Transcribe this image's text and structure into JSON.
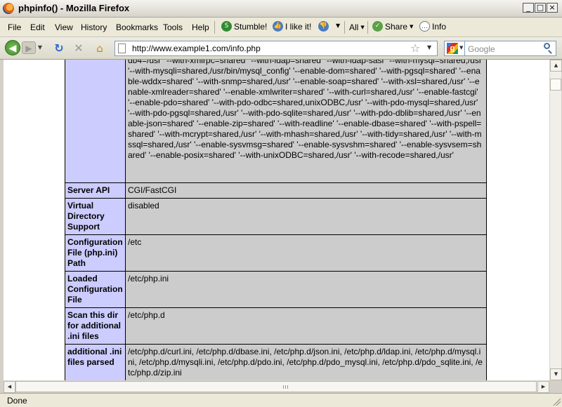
{
  "window": {
    "title": "phpinfo() - Mozilla Firefox",
    "buttons": {
      "minimize": "_",
      "maximize": "□",
      "close": "×"
    }
  },
  "menubar": {
    "items": [
      "File",
      "Edit",
      "View",
      "History",
      "Bookmarks",
      "Tools",
      "Help"
    ]
  },
  "toolbar": {
    "stumble_label": "Stumble!",
    "like_label": "I like it!",
    "all_label": "All",
    "share_label": "Share",
    "info_label": "Info"
  },
  "navbar": {
    "url": "http://www.example1.com/info.php",
    "search_placeholder": "Google"
  },
  "phpinfo": {
    "configure_tail": "db4=/usr' '--with-xmlrpc=shared' '--with-ldap=shared' '--with-ldap-sasl' '--with-mysql=shared,/usr' '--with-mysqli=shared,/usr/bin/mysql_config' '--enable-dom=shared' '--with-pgsql=shared' '--enable-wddx=shared' '--with-snmp=shared,/usr' '--enable-soap=shared' '--with-xsl=shared,/usr' '--enable-xmlreader=shared' '--enable-xmlwriter=shared' '--with-curl=shared,/usr' '--enable-fastcgi' '--enable-pdo=shared' '--with-pdo-odbc=shared,unixODBC,/usr' '--with-pdo-mysql=shared,/usr' '--with-pdo-pgsql=shared,/usr' '--with-pdo-sqlite=shared,/usr' '--with-pdo-dblib=shared,/usr' '--enable-json=shared' '--enable-zip=shared' '--with-readline' '--enable-dbase=shared' '--with-pspell=shared' '--with-mcrypt=shared,/usr' '--with-mhash=shared,/usr' '--with-tidy=shared,/usr' '--with-mssql=shared,/usr' '--enable-sysvmsg=shared' '--enable-sysvshm=shared' '--enable-sysvsem=shared' '--enable-posix=shared' '--with-unixODBC=shared,/usr' '--with-recode=shared,/usr'",
    "rows": [
      {
        "key": "Server API",
        "value": "CGI/FastCGI"
      },
      {
        "key": "Virtual Directory Support",
        "value": "disabled"
      },
      {
        "key": "Configuration File (php.ini) Path",
        "value": "/etc"
      },
      {
        "key": "Loaded Configuration File",
        "value": "/etc/php.ini"
      },
      {
        "key": "Scan this dir for additional .ini files",
        "value": "/etc/php.d"
      },
      {
        "key": "additional .ini files parsed",
        "value": "/etc/php.d/curl.ini, /etc/php.d/dbase.ini, /etc/php.d/json.ini, /etc/php.d/ldap.ini, /etc/php.d/mysql.ini, /etc/php.d/mysqli.ini, /etc/php.d/pdo.ini, /etc/php.d/pdo_mysql.ini, /etc/php.d/pdo_sqlite.ini, /etc/php.d/zip.ini"
      }
    ]
  },
  "status": {
    "text": "Done"
  }
}
